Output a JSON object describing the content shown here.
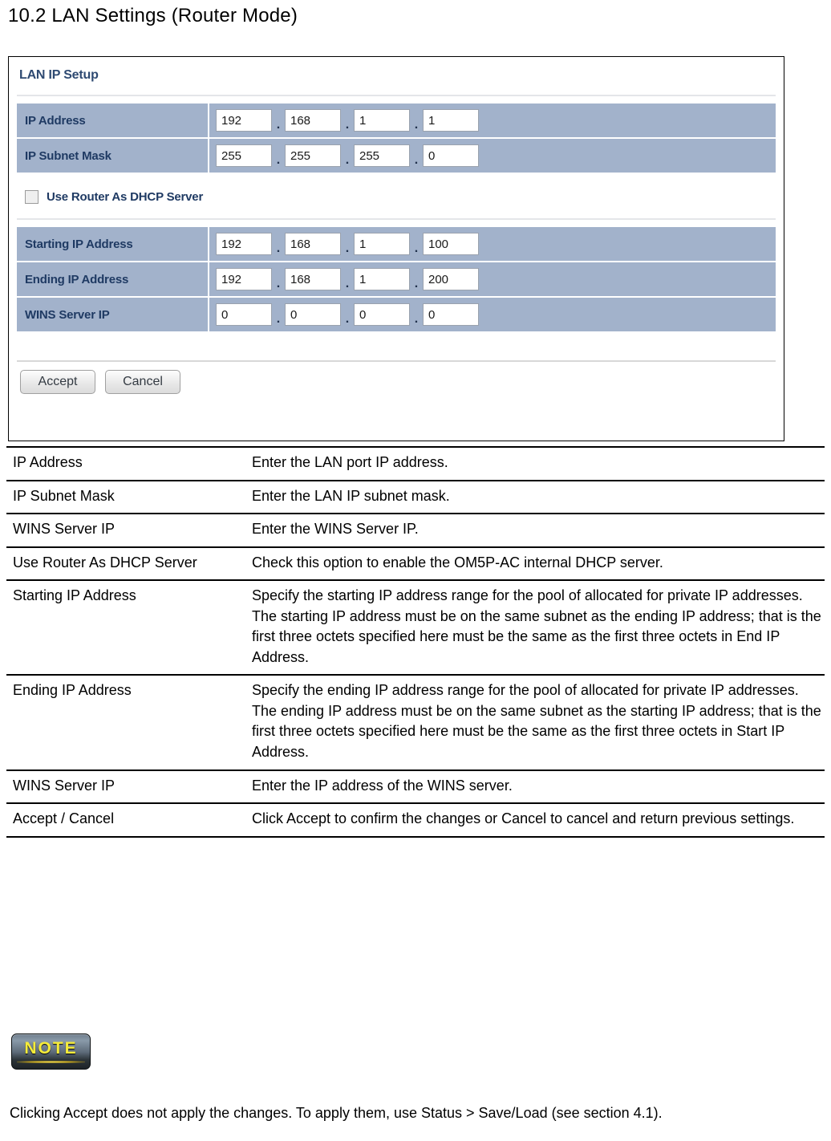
{
  "heading": "10.2 LAN Settings (Router Mode)",
  "router_ui": {
    "panel_title": "LAN IP Setup",
    "ip_rows": [
      {
        "label": "IP Address",
        "octets": [
          "192",
          "168",
          "1",
          "1"
        ]
      },
      {
        "label": "IP Subnet Mask",
        "octets": [
          "255",
          "255",
          "255",
          "0"
        ]
      }
    ],
    "dhcp_checkbox": {
      "label": "Use Router As DHCP Server",
      "checked": false
    },
    "dhcp_rows": [
      {
        "label": "Starting IP Address",
        "octets": [
          "192",
          "168",
          "1",
          "100"
        ]
      },
      {
        "label": "Ending IP Address",
        "octets": [
          "192",
          "168",
          "1",
          "200"
        ]
      },
      {
        "label": "WINS Server IP",
        "octets": [
          "0",
          "0",
          "0",
          "0"
        ]
      }
    ],
    "separator": ".",
    "buttons": {
      "accept": "Accept",
      "cancel": "Cancel"
    },
    "colors": {
      "row_background": "#a2b2cb",
      "label_text": "#1f3a63",
      "panel_title": "#2e4a72",
      "panel_border": "#000000"
    }
  },
  "description_table": {
    "rows": [
      {
        "term": "IP Address",
        "definition": "Enter the LAN port IP address."
      },
      {
        "term": "IP Subnet Mask",
        "definition": "Enter the LAN IP subnet mask."
      },
      {
        "term": "WINS Server IP",
        "definition": "Enter the WINS Server IP."
      },
      {
        "term": "Use Router As DHCP Server",
        "definition": "Check this option to enable the OM5P-AC internal DHCP server."
      },
      {
        "term": "Starting IP Address",
        "definition": "Specify the starting IP address range for the pool of allocated for private IP addresses. The starting IP address must be on the same subnet as the ending IP address; that is the first three octets specified here must be the same as the first three octets in End IP Address."
      },
      {
        "term": "Ending IP Address",
        "definition": "Specify the ending IP address range for the pool of allocated for private IP addresses. The ending IP address must be on the same subnet as the starting IP address; that is the first three octets specified here must be the same as the first three octets in Start IP Address."
      },
      {
        "term": "WINS Server IP",
        "definition": "Enter the IP address of the WINS server."
      },
      {
        "term": "Accept / Cancel",
        "definition": "Click Accept to confirm the changes or Cancel to cancel and return previous settings."
      }
    ]
  },
  "note": {
    "badge_label": "NOTE",
    "badge_colors": {
      "text": "#f5ec3a",
      "background_dark": "#1d2327"
    },
    "text": "Clicking Accept does not apply the changes. To apply them, use Status > Save/Load (see section 4.1)."
  }
}
